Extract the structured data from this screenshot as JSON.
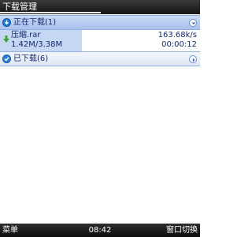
{
  "window": {
    "title": "下载管理"
  },
  "sections": {
    "downloading": {
      "label": "正在下载(1)"
    },
    "downloaded": {
      "label": "已下载(6)"
    }
  },
  "download_item": {
    "filename": "压缩.rar",
    "progress_text": "1.42M/3.38M",
    "speed": "163.68k/s",
    "elapsed": "00:00:12"
  },
  "softkeys": {
    "left": "菜单",
    "time": "08:42",
    "right": "窗口切换"
  },
  "colors": {
    "accent": "#1f7ad9",
    "header_expanded": "#b8cdf2",
    "header_collapsed": "#e8eef9"
  },
  "icons": {
    "downloading_section": "download-icon",
    "downloaded_section": "check-icon",
    "expanded_toggle": "chevron-down-icon",
    "collapsed_toggle": "chevron-right-icon",
    "item_status": "download-arrow-icon"
  }
}
